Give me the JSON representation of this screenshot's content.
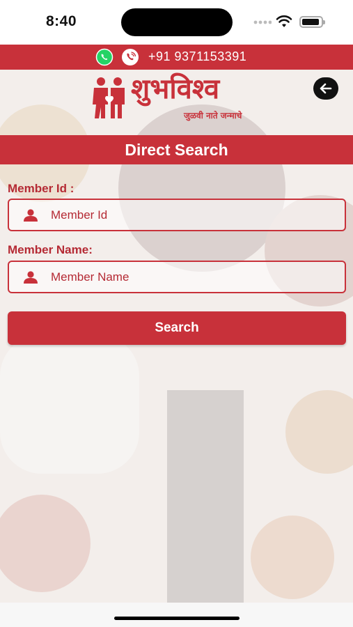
{
  "status_bar": {
    "time": "8:40"
  },
  "contact": {
    "whatsapp_icon": "whatsapp-icon",
    "phone_icon": "phone-icon",
    "number": "+91 9371153391"
  },
  "brand": {
    "name": "शुभविश्व",
    "tagline": "जुळवी नाते जन्माचे"
  },
  "header": {
    "back_icon": "arrow-left-icon",
    "title": "Direct Search"
  },
  "form": {
    "member_id": {
      "label": "Member Id :",
      "placeholder": "Member Id",
      "value": ""
    },
    "member_name": {
      "label": "Member Name:",
      "placeholder": "Member Name",
      "value": ""
    },
    "search_label": "Search"
  },
  "colors": {
    "brand_red": "#c8313a",
    "text_red": "#b52a34"
  }
}
